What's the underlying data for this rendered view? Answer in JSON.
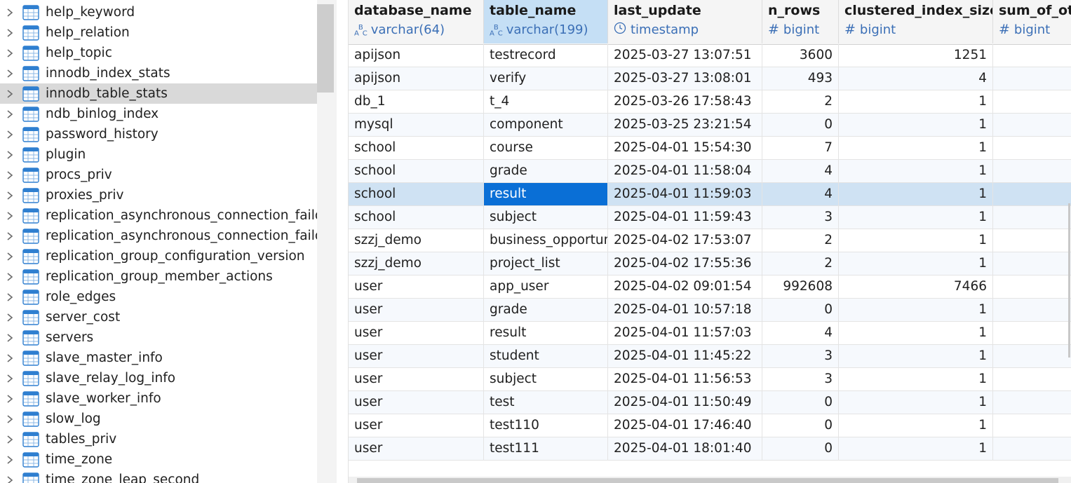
{
  "tree": {
    "selected_index": 4,
    "items": [
      {
        "label": "help_keyword"
      },
      {
        "label": "help_relation"
      },
      {
        "label": "help_topic"
      },
      {
        "label": "innodb_index_stats"
      },
      {
        "label": "innodb_table_stats"
      },
      {
        "label": "ndb_binlog_index"
      },
      {
        "label": "password_history"
      },
      {
        "label": "plugin"
      },
      {
        "label": "procs_priv"
      },
      {
        "label": "proxies_priv"
      },
      {
        "label": "replication_asynchronous_connection_failove"
      },
      {
        "label": "replication_asynchronous_connection_failove"
      },
      {
        "label": "replication_group_configuration_version"
      },
      {
        "label": "replication_group_member_actions"
      },
      {
        "label": "role_edges"
      },
      {
        "label": "server_cost"
      },
      {
        "label": "servers"
      },
      {
        "label": "slave_master_info"
      },
      {
        "label": "slave_relay_log_info"
      },
      {
        "label": "slave_worker_info"
      },
      {
        "label": "slow_log"
      },
      {
        "label": "tables_priv"
      },
      {
        "label": "time_zone"
      },
      {
        "label": "time_zone_leap_second"
      }
    ]
  },
  "grid": {
    "selected_column": "table_name",
    "selected_row": 6,
    "columns": [
      {
        "name": "database_name",
        "type": "varchar(64)",
        "type_icon": "abc-icon"
      },
      {
        "name": "table_name",
        "type": "varchar(199)",
        "type_icon": "abc-icon"
      },
      {
        "name": "last_update",
        "type": "timestamp",
        "type_icon": "clock-icon"
      },
      {
        "name": "n_rows",
        "type": "bigint",
        "type_icon": "hash-icon"
      },
      {
        "name": "clustered_index_size",
        "type": "bigint",
        "type_icon": "hash-icon"
      },
      {
        "name": "sum_of_ot",
        "type": "bigint",
        "type_icon": "hash-icon"
      }
    ],
    "rows": [
      [
        "apijson",
        "testrecord",
        "2025-03-27 13:07:51",
        "3600",
        "1251",
        ""
      ],
      [
        "apijson",
        "verify",
        "2025-03-27 13:08:01",
        "493",
        "4",
        ""
      ],
      [
        "db_1",
        "t_4",
        "2025-03-26 17:58:43",
        "2",
        "1",
        ""
      ],
      [
        "mysql",
        "component",
        "2025-03-25 23:21:54",
        "0",
        "1",
        ""
      ],
      [
        "school",
        "course",
        "2025-04-01 15:54:30",
        "7",
        "1",
        ""
      ],
      [
        "school",
        "grade",
        "2025-04-01 11:58:04",
        "4",
        "1",
        ""
      ],
      [
        "school",
        "result",
        "2025-04-01 11:59:03",
        "4",
        "1",
        ""
      ],
      [
        "school",
        "subject",
        "2025-04-01 11:59:43",
        "3",
        "1",
        ""
      ],
      [
        "szzj_demo",
        "business_opportun",
        "2025-04-02 17:53:07",
        "2",
        "1",
        ""
      ],
      [
        "szzj_demo",
        "project_list",
        "2025-04-02 17:55:36",
        "2",
        "1",
        ""
      ],
      [
        "user",
        "app_user",
        "2025-04-02 09:01:54",
        "992608",
        "7466",
        ""
      ],
      [
        "user",
        "grade",
        "2025-04-01 10:57:18",
        "0",
        "1",
        ""
      ],
      [
        "user",
        "result",
        "2025-04-01 11:57:03",
        "4",
        "1",
        ""
      ],
      [
        "user",
        "student",
        "2025-04-01 11:45:22",
        "3",
        "1",
        ""
      ],
      [
        "user",
        "subject",
        "2025-04-01 11:56:53",
        "3",
        "1",
        ""
      ],
      [
        "user",
        "test",
        "2025-04-01 11:50:49",
        "0",
        "1",
        ""
      ],
      [
        "user",
        "test110",
        "2025-04-01 17:46:40",
        "0",
        "1",
        ""
      ],
      [
        "user",
        "test111",
        "2025-04-01 18:01:40",
        "0",
        "1",
        ""
      ]
    ]
  },
  "colors": {
    "accent": "#0a6fd6",
    "selected_row": "#cfe2f3",
    "selected_header": "#c5dff5",
    "type_text": "#3b6fb6",
    "tree_selected": "#d9d9d9"
  }
}
